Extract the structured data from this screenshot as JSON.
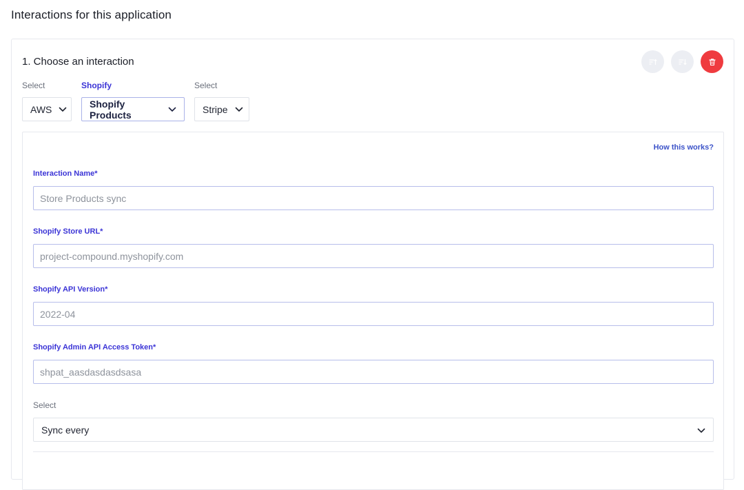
{
  "page": {
    "title": "Interactions for this application"
  },
  "card": {
    "heading": "1. Choose an interaction",
    "actions": [
      {
        "name": "move-up-button",
        "icon": "sort-up-icon"
      },
      {
        "name": "move-down-button",
        "icon": "sort-down-icon"
      },
      {
        "name": "delete-button",
        "icon": "trash-icon"
      }
    ]
  },
  "selectors": [
    {
      "label": "Select",
      "value": "AWS",
      "active": false
    },
    {
      "label": "Shopify",
      "value": "Shopify Products",
      "active": true
    },
    {
      "label": "Select",
      "value": "Stripe",
      "active": false
    }
  ],
  "form": {
    "help_link": "How this works?",
    "interaction_name": {
      "label": "Interaction Name*",
      "placeholder": "Store Products sync"
    },
    "store_url": {
      "label": "Shopify Store URL*",
      "placeholder": "project-compound.myshopify.com"
    },
    "api_version": {
      "label": "Shopify API Version*",
      "placeholder": "2022-04"
    },
    "access_token": {
      "label": "Shopify Admin API Access Token*",
      "placeholder": "shpat_aasdasdasdsasa"
    },
    "sync": {
      "label": "Select",
      "value": "Sync every"
    }
  },
  "colors": {
    "accent": "#3b34d6",
    "link": "#3b52c8",
    "danger": "#ef3b3f",
    "ghost": "#eceef3"
  }
}
